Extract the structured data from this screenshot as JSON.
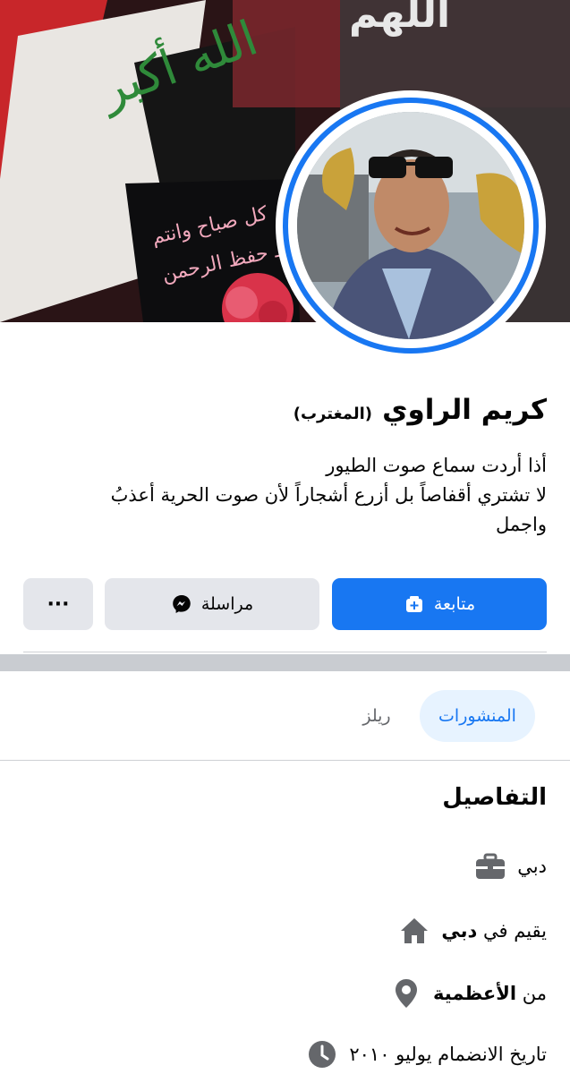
{
  "profile": {
    "name": "كريم الراوي",
    "alternate_name": "(المغترب)",
    "bio_lines": [
      "أذا أردت سماع صوت الطيور",
      "لا تشتري أقفاصاً بل أزرع أشجاراً  لأن صوت الحرية أعذبُ",
      "واجمل"
    ]
  },
  "cover": {
    "text_top": "اللهم",
    "flag_text": "الله أكبر",
    "card_text_1": "كل صباح وانتم",
    "card_text_2": "بـ حفظ الرحمن"
  },
  "actions": {
    "follow_label": "متابعة",
    "message_label": "مراسلة",
    "more_label": "···"
  },
  "tabs": {
    "posts": "المنشورات",
    "reels": "ريلز"
  },
  "details": {
    "title": "التفاصيل",
    "work": "دبي",
    "lives_prefix": "يقيم في",
    "lives_place": "دبي",
    "from_prefix": "من",
    "from_place": "الأعظمية",
    "joined": "تاريخ الانضمام يوليو ٢٠١٠"
  },
  "icons": {
    "work": "briefcase-icon",
    "lives": "home-icon",
    "from": "location-pin-icon",
    "joined": "clock-icon",
    "follow": "add-friend-icon",
    "message": "messenger-icon"
  },
  "colors": {
    "accent": "#1877f2",
    "secondary_button": "#e4e6eb",
    "icon_gray": "#65676b",
    "tab_active_bg": "#e7f3ff"
  }
}
